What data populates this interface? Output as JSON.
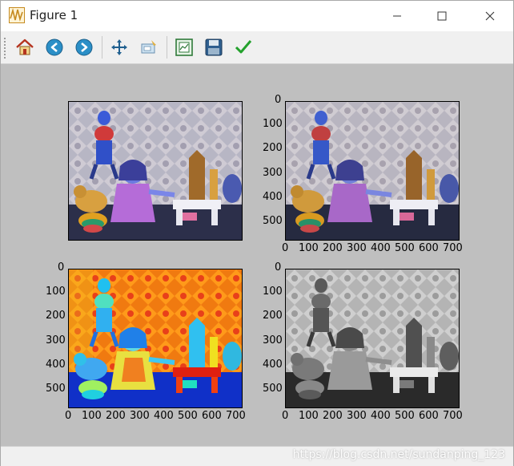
{
  "window": {
    "title": "Figure 1"
  },
  "toolbar": {
    "buttons": [
      {
        "name": "home",
        "icon": "home-icon"
      },
      {
        "name": "back",
        "icon": "arrow-left-icon"
      },
      {
        "name": "forward",
        "icon": "arrow-right-icon"
      },
      {
        "name": "pan",
        "icon": "move-icon"
      },
      {
        "name": "zoom",
        "icon": "zoom-rect-icon"
      },
      {
        "name": "subplots",
        "icon": "subplots-icon"
      },
      {
        "name": "save",
        "icon": "save-icon"
      },
      {
        "name": "edit",
        "icon": "checkmark-icon"
      }
    ]
  },
  "plots": {
    "top_right": {
      "y_ticks": [
        "0",
        "100",
        "200",
        "300",
        "400",
        "500"
      ],
      "x_ticks": [
        "0",
        "100",
        "200",
        "300",
        "400",
        "500",
        "600",
        "700"
      ]
    },
    "bottom_left": {
      "y_ticks": [
        "0",
        "100",
        "200",
        "300",
        "400",
        "500"
      ],
      "x_ticks": [
        "0",
        "100",
        "200",
        "300",
        "400",
        "500",
        "600",
        "700"
      ]
    },
    "bottom_right": {
      "y_ticks": [
        "0",
        "100",
        "200",
        "300",
        "400",
        "500"
      ],
      "x_ticks": [
        "0",
        "100",
        "200",
        "300",
        "400",
        "500",
        "600",
        "700"
      ]
    }
  },
  "status": {
    "watermark": "https://blog.csdn.net/sundanping_123"
  },
  "colors": {
    "canvas": "#bfbfbf",
    "toolbar": "#f0f0f0"
  }
}
